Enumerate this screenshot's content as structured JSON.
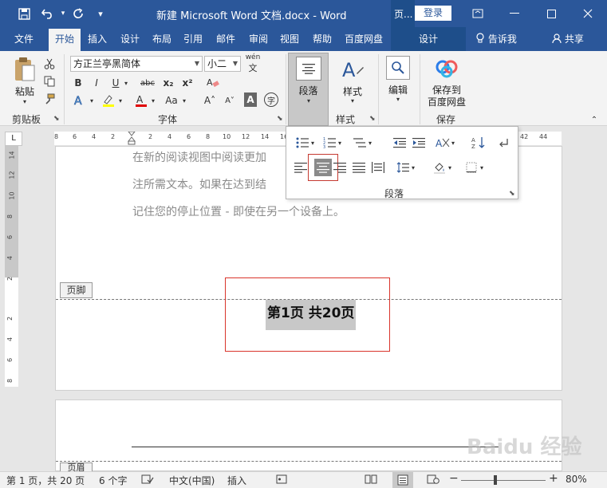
{
  "titlebar": {
    "doc_title": "新建 Microsoft Word 文档.docx  -  Word",
    "context_label": "页...",
    "login_label": "登录",
    "save_icon": "save-icon",
    "undo_icon": "undo-icon",
    "redo_icon": "redo-icon"
  },
  "tabs": [
    "文件",
    "开始",
    "插入",
    "设计",
    "布局",
    "引用",
    "邮件",
    "审阅",
    "视图",
    "帮助",
    "百度网盘",
    "设计"
  ],
  "tell_me": "告诉我",
  "share": "共享",
  "ribbon": {
    "clipboard": {
      "paste": "粘贴",
      "label": "剪贴板"
    },
    "font": {
      "font_name": "方正兰亭黑简体",
      "font_size": "小二",
      "pinyin": "wén",
      "label": "字体",
      "bold": "B",
      "italic": "I",
      "underline": "U",
      "strike": "abc",
      "subscript": "x₂",
      "superscript": "x²",
      "aa_case": "Aa",
      "grow": "A˄",
      "shrink": "A˅",
      "char_border": "A",
      "phonetic": "字"
    },
    "paragraph": {
      "label": "段落"
    },
    "styles": {
      "label": "样式",
      "button": "样式"
    },
    "editing": {
      "label": "编辑",
      "button": "编辑"
    },
    "save_baidu": {
      "button_line1": "保存到",
      "button_line2": "百度网盘",
      "label": "保存"
    }
  },
  "ruler": {
    "corner": "L",
    "h_ticks": [
      "8",
      "6",
      "4",
      "2",
      "2",
      "4",
      "6",
      "8",
      "10",
      "12",
      "14",
      "16",
      "18",
      "20",
      "22",
      "42",
      "44"
    ],
    "v_ticks": [
      "14",
      "12",
      "10",
      "8",
      "6",
      "4",
      "2",
      "2",
      "4",
      "6",
      "8"
    ]
  },
  "document": {
    "line1": "在新的阅读视图中阅读更加",
    "line2": "注所需文本。如果在达到结",
    "line3": "记住您的停止位置 - 即使在另一个设备上。",
    "footer_tag": "页脚",
    "page_number_text": "第1页 共20页",
    "header_tag": "页眉"
  },
  "para_panel": {
    "label": "段落"
  },
  "watermark": "Baidu 经验",
  "statusbar": {
    "page_info": "第 1 页，共 20 页",
    "word_count": "6 个字",
    "language": "中文(中国)",
    "mode": "插入",
    "zoom": "80%",
    "zoom_minus": "−",
    "zoom_plus": "+"
  }
}
